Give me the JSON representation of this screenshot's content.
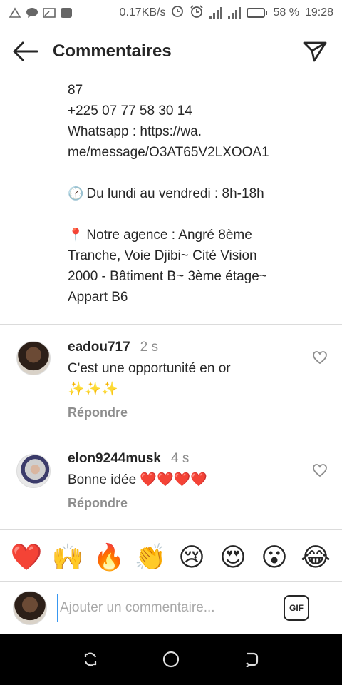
{
  "status_bar": {
    "speed": "0.17KB/s",
    "battery_percent": "58 %",
    "battery_level": 0.58,
    "time": "19:28",
    "icons": [
      "warning-icon",
      "chat-icon",
      "screen-cast-icon",
      "app-icon",
      "data-saver-icon",
      "alarm-icon",
      "signal-icon",
      "signal-4g-icon",
      "battery-icon"
    ]
  },
  "header": {
    "title": "Commentaires",
    "back_icon": "arrow-left-icon",
    "send_icon": "paper-plane-icon"
  },
  "caption": {
    "lines": [
      "87",
      "+225 07 77 58 30 14",
      "Whatsapp : https://wa.",
      "me/message/O3AT65V2LXOOA1",
      "",
      "Du lundi au vendredi : 8h-18h",
      "",
      "Notre agence : Angré 8ème",
      "Tranche, Voie Djibi~ Cité Vision",
      "2000 - Bâtiment B~ 3ème étage~",
      "Appart B6"
    ],
    "clock_emoji": "🕜",
    "pin_emoji": "📍"
  },
  "comments": [
    {
      "username": "eadou717",
      "time": "2 s",
      "text_line1": "C'est une opportunité en or",
      "text_line2": "✨✨✨",
      "reply_label": "Répondre"
    },
    {
      "username": "elon9244musk",
      "time": "4 s",
      "text_line1": "Bonne idée ❤️❤️❤️❤️",
      "reply_label": "Répondre"
    }
  ],
  "emoji_bar": [
    "❤️",
    "🙌",
    "🔥",
    "👏",
    "😢",
    "😍",
    "😮",
    "😂"
  ],
  "composer": {
    "placeholder": "Ajouter un commentaire...",
    "gif_label": "GIF"
  },
  "colors": {
    "text": "#262626",
    "muted": "#8e8e8e",
    "divider": "#dbdbdb",
    "nav_bar": "#000000"
  }
}
